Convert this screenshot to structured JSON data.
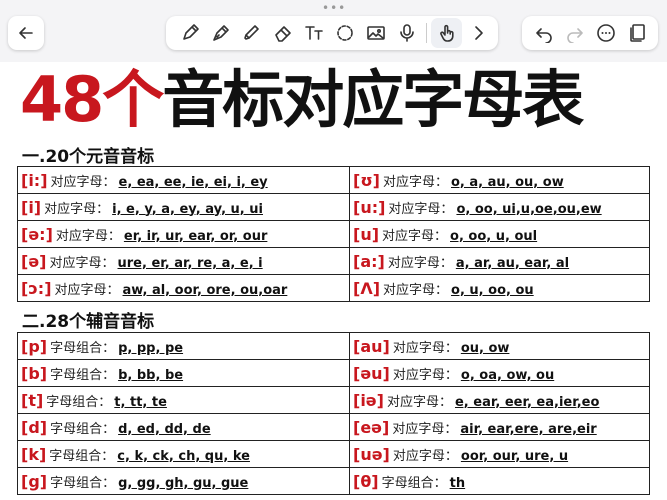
{
  "toolbar": {
    "tools": [
      {
        "icon": "pen-icon"
      },
      {
        "icon": "fountain-pen-icon"
      },
      {
        "icon": "highlighter-icon"
      },
      {
        "icon": "eraser-icon"
      },
      {
        "icon": "text-tool-icon"
      },
      {
        "icon": "lasso-icon"
      },
      {
        "icon": "image-icon"
      },
      {
        "icon": "microphone-icon"
      },
      {
        "icon": "hand-touch-icon"
      },
      {
        "icon": "chevron-right-icon"
      }
    ],
    "right": [
      {
        "icon": "undo-icon"
      },
      {
        "icon": "redo-icon"
      },
      {
        "icon": "more-icon"
      },
      {
        "icon": "pages-icon"
      }
    ]
  },
  "document": {
    "title_number": "48个",
    "title_rest": "音标对应字母表",
    "vowels_heading": "一.20个元音音标",
    "consonants_heading": "二.28个辅音音标",
    "vowel_rows": [
      [
        {
          "sym": "[i:]",
          "label": "对应字母：",
          "letters": "e, ea, ee, ie, ei, i, ey"
        },
        {
          "sym": "[ʊ]",
          "label": "对应字母：",
          "letters": "o, a, au, ou, ow"
        }
      ],
      [
        {
          "sym": "[i]",
          "label": "对应字母：",
          "letters": "i, e, y, a, ey, ay, u, ui"
        },
        {
          "sym": "[u:]",
          "label": "对应字母：",
          "letters": "o, oo, ui,u,oe,ou,ew"
        }
      ],
      [
        {
          "sym": "[ə:]",
          "label": "对应字母：",
          "letters": "er, ir, ur, ear, or, our"
        },
        {
          "sym": "[u]",
          "label": "对应字母：",
          "letters": "o, oo, u, oul"
        }
      ],
      [
        {
          "sym": "[ə]",
          "label": "对应字母：",
          "letters": "ure, er, ar, re, a, e, i"
        },
        {
          "sym": "[a:]",
          "label": "对应字母：",
          "letters": "a, ar, au, ear, al"
        }
      ],
      [
        {
          "sym": "[ɔ:]",
          "label": "对应字母：",
          "letters": "aw, al, oor, ore, ou,oar"
        },
        {
          "sym": "[Λ]",
          "label": "对应字母：",
          "letters": "o, u, oo, ou"
        }
      ]
    ],
    "consonant_rows": [
      [
        {
          "sym": "[p]",
          "label": "字母组合：",
          "letters": "p, pp, pe"
        },
        {
          "sym": "[au]",
          "label": "对应字母：",
          "letters": "ou, ow"
        }
      ],
      [
        {
          "sym": "[b]",
          "label": "字母组合：",
          "letters": "b, bb, be"
        },
        {
          "sym": "[əu]",
          "label": "对应字母：",
          "letters": "o, oa, ow, ou"
        }
      ],
      [
        {
          "sym": "[t]",
          "label": "字母组合：",
          "letters": "t, tt, te"
        },
        {
          "sym": "[iə]",
          "label": "对应字母：",
          "letters": "e, ear, eer, ea,ier,eo"
        }
      ],
      [
        {
          "sym": "[d]",
          "label": "字母组合：",
          "letters": "d, ed, dd, de"
        },
        {
          "sym": "[eə]",
          "label": "对应字母：",
          "letters": "air, ear,ere, are,eir"
        }
      ],
      [
        {
          "sym": "[k]",
          "label": "字母组合：",
          "letters": "c, k, ck, ch, qu, ke"
        },
        {
          "sym": "[uə]",
          "label": "对应字母：",
          "letters": "oor, our, ure, u"
        }
      ],
      [
        {
          "sym": "[g]",
          "label": "字母组合：",
          "letters": "g, gg, gh, gu, gue"
        },
        {
          "sym": "[θ]",
          "label": "字母组合：",
          "letters": "th"
        }
      ]
    ]
  }
}
